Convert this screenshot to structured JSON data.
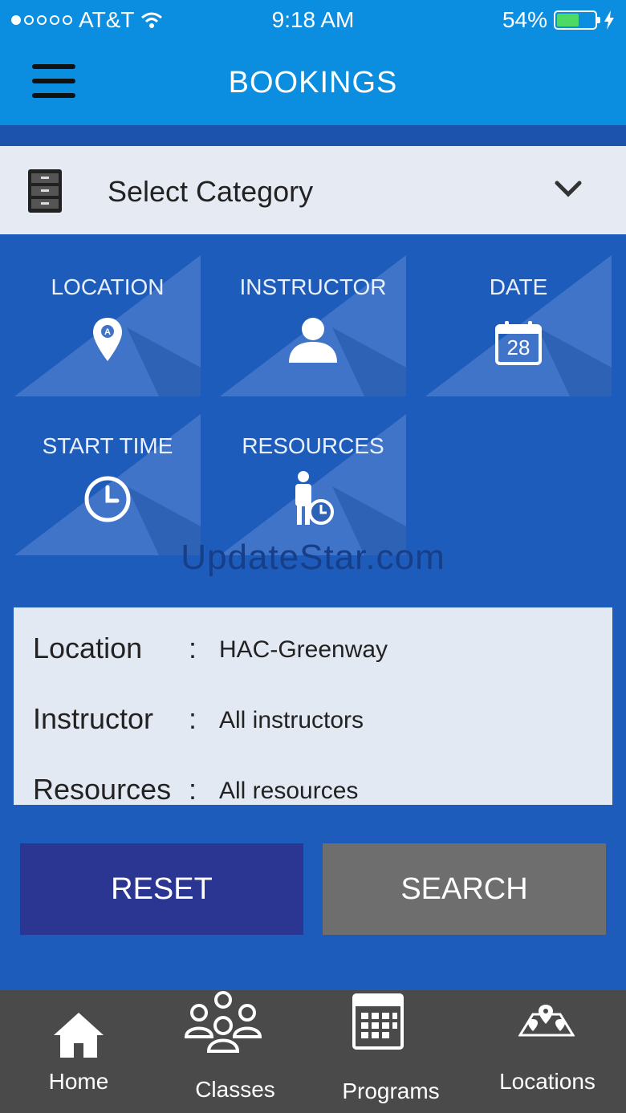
{
  "status_bar": {
    "carrier": "AT&T",
    "time": "9:18 AM",
    "battery": "54%"
  },
  "header": {
    "title": "BOOKINGS"
  },
  "category": {
    "label": "Select Category"
  },
  "tiles": [
    {
      "label": "LOCATION"
    },
    {
      "label": "INSTRUCTOR"
    },
    {
      "label": "DATE",
      "day": "28"
    },
    {
      "label": "START TIME"
    },
    {
      "label": "RESOURCES"
    }
  ],
  "watermark": "UpdateStar.com",
  "summary": {
    "rows": [
      {
        "key": "Location",
        "value": "HAC-Greenway"
      },
      {
        "key": "Instructor",
        "value": "All instructors"
      },
      {
        "key": "Resources",
        "value": "All resources"
      }
    ],
    "separator": ":"
  },
  "actions": {
    "reset_label": "RESET",
    "search_label": "SEARCH"
  },
  "tabbar": {
    "items": [
      {
        "label": "Home",
        "icon": "home-icon"
      },
      {
        "label": "Classes",
        "icon": "people-group-icon"
      },
      {
        "label": "Programs",
        "icon": "calendar-grid-icon"
      },
      {
        "label": "Locations",
        "icon": "map-pins-icon"
      }
    ]
  },
  "colors": {
    "header": "#0b8ee0",
    "background": "#1e5cbc",
    "reset": "#2b3592",
    "search": "#6e6e6e",
    "tabbar": "#4a4a4a"
  }
}
